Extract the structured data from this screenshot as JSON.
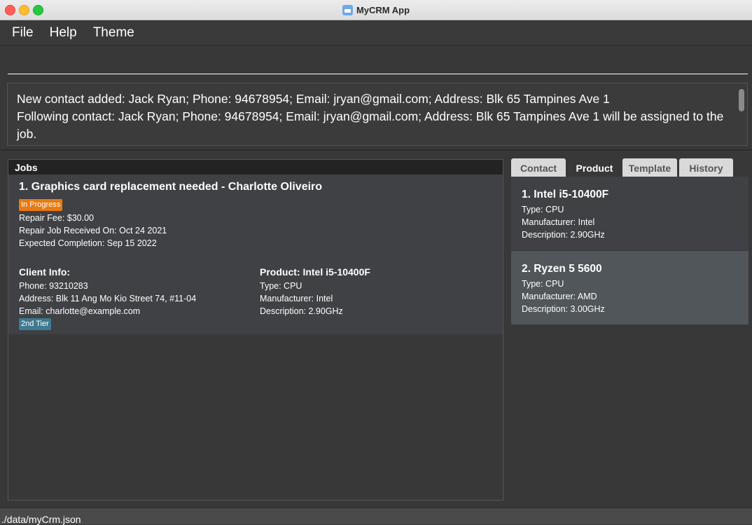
{
  "window": {
    "title": "MyCRM App"
  },
  "menu": [
    "File",
    "Help",
    "Theme"
  ],
  "command": {
    "value": ""
  },
  "result": {
    "lines": [
      "New contact added: Jack Ryan; Phone: 94678954; Email: jryan@gmail.com; Address: Blk 65 Tampines Ave 1",
      "Following contact: Jack Ryan; Phone: 94678954; Email: jryan@gmail.com; Address: Blk 65 Tampines Ave 1 will be assigned to the",
      "job."
    ]
  },
  "jobs": {
    "header": "Jobs",
    "card": {
      "title": "1. Graphics card replacement needed - Charlotte Oliveiro",
      "status": "In Progress",
      "status_color": "#e87a11",
      "repair_fee": "Repair Fee: $30.00",
      "received": "Repair Job Received On: Oct 24 2021",
      "expected": "Expected Completion: Sep 15 2022",
      "client": {
        "heading": "Client Info:",
        "phone": "Phone: 93210283",
        "address": "Address: Blk 11 Ang Mo Kio Street 74, #11-04",
        "email": "Email: charlotte@example.com",
        "tier": "2nd Tier",
        "tier_color": "#3e7a91"
      },
      "product": {
        "heading": "Product: Intel i5-10400F",
        "type": "Type: CPU",
        "manufacturer": "Manufacturer: Intel",
        "description": "Description: 2.90GHz"
      }
    }
  },
  "tabs": [
    {
      "label": "Contact",
      "active": false
    },
    {
      "label": "Product",
      "active": true
    },
    {
      "label": "Template",
      "active": false
    },
    {
      "label": "History",
      "active": false
    }
  ],
  "products": [
    {
      "name": "1.  Intel i5-10400F",
      "type": "Type: CPU",
      "manufacturer": "Manufacturer: Intel",
      "description": "Description: 2.90GHz",
      "selected": false
    },
    {
      "name": "2.  Ryzen 5 5600",
      "type": "Type: CPU",
      "manufacturer": "Manufacturer: AMD",
      "description": "Description: 3.00GHz",
      "selected": true
    }
  ],
  "status_bar": {
    "path": "./data/myCrm.json"
  }
}
